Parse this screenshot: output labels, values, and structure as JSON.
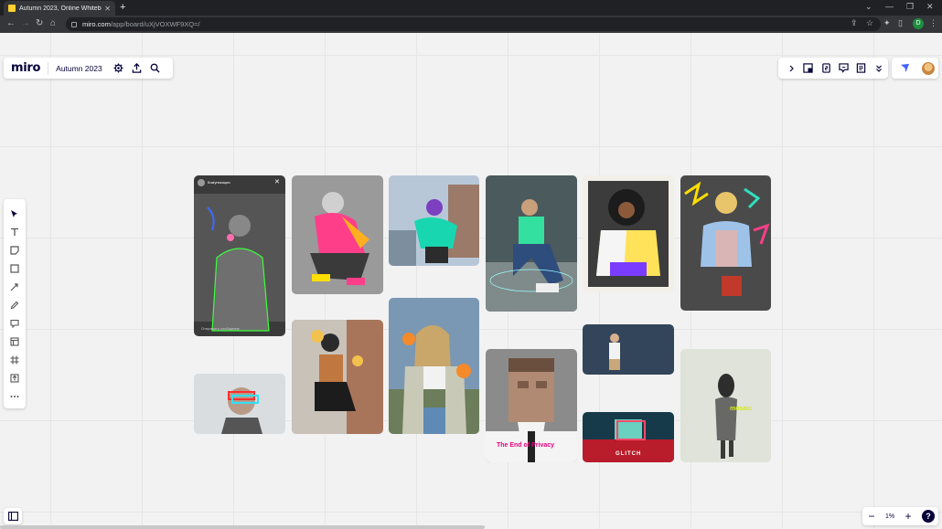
{
  "browser": {
    "tab_title": "Autumn 2023, Online Whiteboar...",
    "url_domain": "miro.com",
    "url_path": "/app/board/uXjVOXWF9XQ=/",
    "profile_initial": "D"
  },
  "board": {
    "logo": "miro",
    "name": "Autumn 2023",
    "zoom_level": "1%",
    "help_label": "?"
  },
  "images": {
    "story_username": "Комуникация",
    "story_message": "Отправить сообщение",
    "privacy_title": "The End of Privacy",
    "glitch_label": "GLITCH",
    "poster_word": "mosaic"
  }
}
